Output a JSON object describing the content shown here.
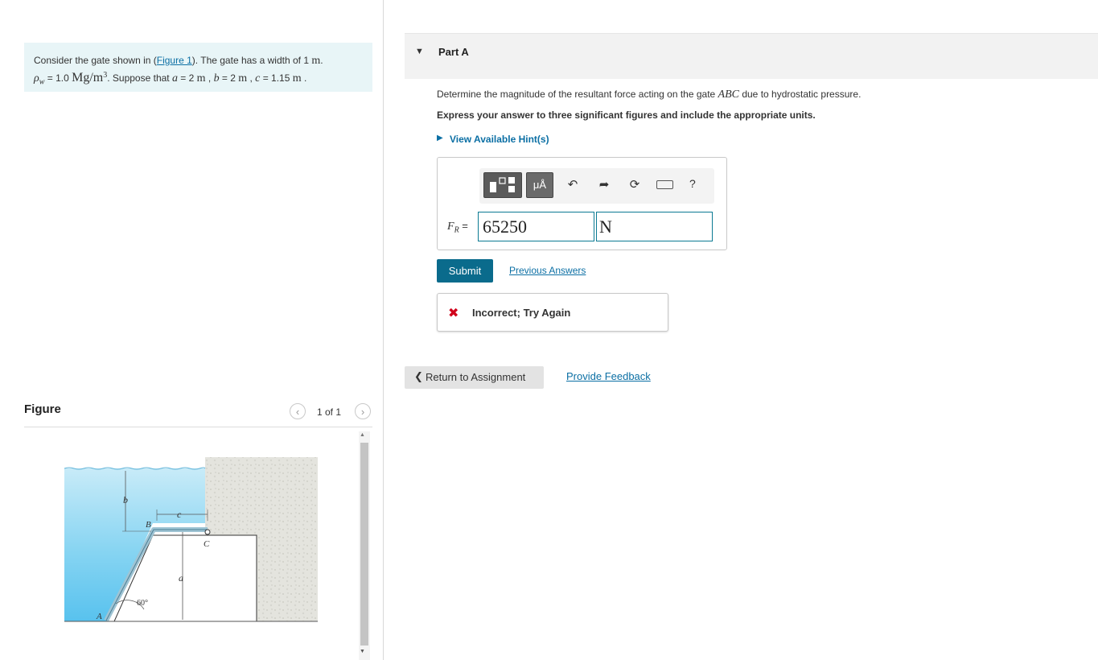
{
  "intro": {
    "t1": "Consider the gate shown in (",
    "figure_link": "Figure 1",
    "t2": "). The gate has a width of 1 ",
    "width_unit": "m",
    "t3": ".",
    "rho_symbol": "ρ",
    "rho_sub": "w",
    "t4": " = 1.0 ",
    "rho_unit": "Mg/m",
    "rho_exp": "3",
    "t5": ". Suppose that ",
    "a_sym": "a",
    "t6": " = 2 ",
    "a_unit": "m",
    "t7": " , ",
    "b_sym": "b",
    "t8": " = 2 ",
    "b_unit": "m",
    "t9": " , ",
    "c_sym": "c",
    "t10": " = 1.15 ",
    "c_unit": "m",
    "t11": " ."
  },
  "figure": {
    "title": "Figure",
    "counter": "1 of 1",
    "prev_icon": "chevron-left-icon",
    "next_icon": "chevron-right-icon",
    "labels": {
      "b": "b",
      "c": "c",
      "B": "B",
      "C": "C",
      "a": "a",
      "A": "A",
      "angle": "60°"
    }
  },
  "part": {
    "caret": "▼",
    "title": "Part A",
    "question_pre": "Determine the magnitude of the resultant force acting on the gate ",
    "question_sym": "ABC",
    "question_post": " due to hydrostatic pressure.",
    "instruction": "Express your answer to three significant figures and include the appropriate units.",
    "hint_caret": "▶",
    "hint": "View Available Hint(s)"
  },
  "answer": {
    "toolbar": {
      "template_icon": "templates-icon",
      "units_label": "μÅ",
      "undo_icon": "undo-icon",
      "redo_icon": "redo-icon",
      "reset_icon": "reset-icon",
      "keyboard_icon": "keyboard-icon",
      "help_label": "?"
    },
    "label_sym": "F",
    "label_sub": "R",
    "label_eq": " =",
    "value": "65250",
    "units": "N"
  },
  "actions": {
    "submit": "Submit",
    "previous_answers": "Previous Answers"
  },
  "feedback": {
    "icon": "✖",
    "text": "Incorrect; Try Again"
  },
  "footer": {
    "return_chevron": "❮",
    "return": "Return to Assignment",
    "provide_feedback": "Provide Feedback"
  },
  "colors": {
    "accent": "#0a6b8c",
    "link": "#0b6fa4",
    "error": "#d0021b",
    "intro_bg": "#e8f5f7",
    "water": "#5bc3ee"
  }
}
